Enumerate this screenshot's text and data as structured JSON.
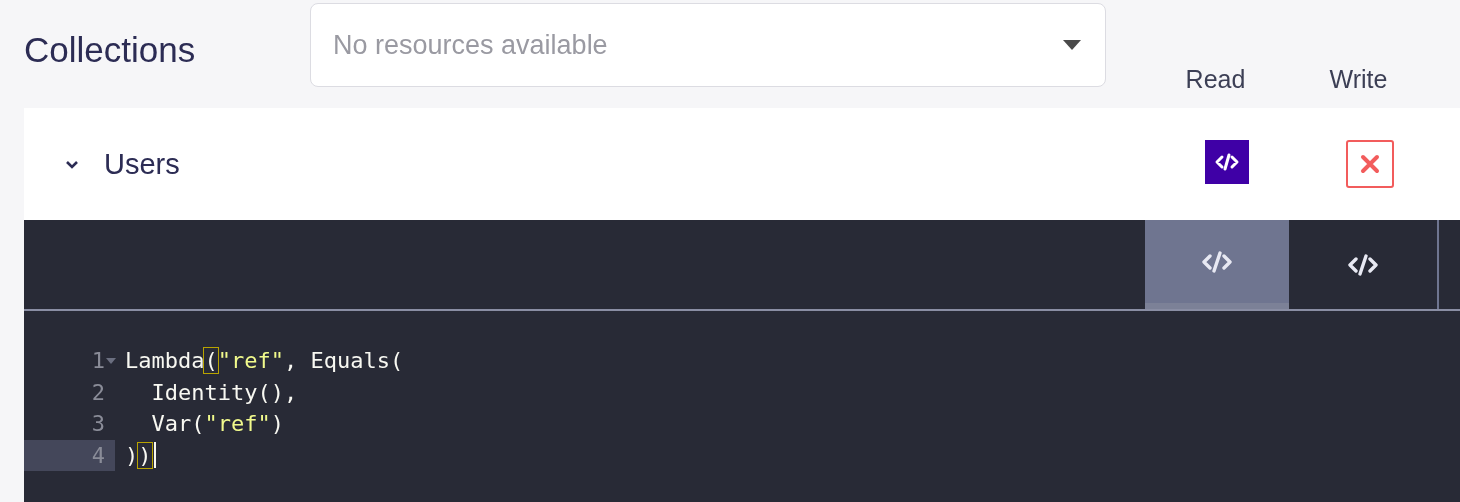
{
  "title": "Collections",
  "resource_select": {
    "placeholder": "No resources available"
  },
  "permission_columns": [
    "Read",
    "Write"
  ],
  "collection": {
    "name": "Users",
    "expanded": true,
    "permissions": [
      {
        "kind": "custom"
      },
      {
        "kind": "denied"
      }
    ]
  },
  "editor_tabs": [
    {
      "selected": true
    },
    {
      "selected": false
    }
  ],
  "code_lines": [
    {
      "number": "1",
      "foldable": true,
      "active": false,
      "tokens": [
        {
          "kind": "plain",
          "text": "Lambda"
        },
        {
          "kind": "bracket",
          "text": "("
        },
        {
          "kind": "string",
          "text": "\"ref\""
        },
        {
          "kind": "plain",
          "text": ", Equals("
        }
      ]
    },
    {
      "number": "2",
      "foldable": false,
      "active": false,
      "tokens": [
        {
          "kind": "plain",
          "text": "  Identity(),"
        }
      ]
    },
    {
      "number": "3",
      "foldable": false,
      "active": false,
      "tokens": [
        {
          "kind": "plain",
          "text": "  Var("
        },
        {
          "kind": "string",
          "text": "\"ref\""
        },
        {
          "kind": "plain",
          "text": ")"
        }
      ]
    },
    {
      "number": "4",
      "foldable": false,
      "active": true,
      "tokens": [
        {
          "kind": "plain",
          "text": ")"
        },
        {
          "kind": "bracket",
          "text": ")"
        }
      ]
    }
  ]
}
